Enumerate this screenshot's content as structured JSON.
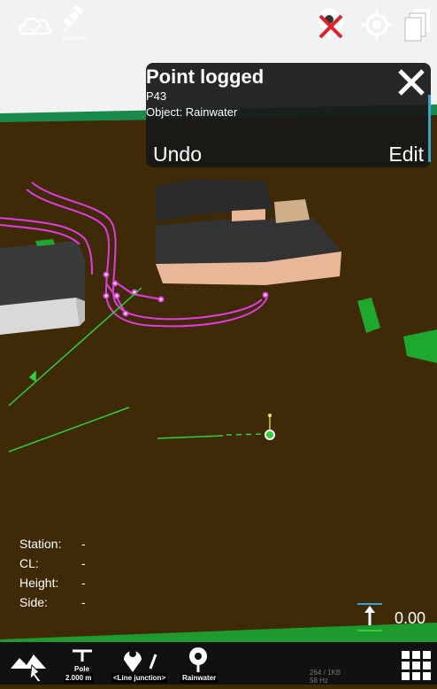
{
  "toolbar": {
    "satellites_label": "Satellites"
  },
  "toast": {
    "title": "Point logged",
    "point_id": "P43",
    "object_line": "Object: Rainwater",
    "undo_label": "Undo",
    "edit_label": "Edit"
  },
  "info_panel": {
    "rows": [
      {
        "label": "Station:",
        "value": "-"
      },
      {
        "label": "CL:",
        "value": "-"
      },
      {
        "label": "Height:",
        "value": "-"
      },
      {
        "label": "Side:",
        "value": "-"
      }
    ]
  },
  "height_indicator": {
    "value": "0.00"
  },
  "bottom_bar": {
    "pole_title": "Pole",
    "pole_value": "2.000 m",
    "line_label": "<Line junction>",
    "object_label": "Rainwater",
    "small_line1": "264 / 1KB",
    "small_line2": "58 Hz"
  },
  "colors": {
    "sky": "#f0f0f0",
    "ground": "#3f2a08",
    "toast_bg": "#181818",
    "accent_blue": "#3aa0d8",
    "pipe_magenta": "#e23ce0",
    "line_green": "#2fd13a",
    "close_red": "#e0202a"
  }
}
